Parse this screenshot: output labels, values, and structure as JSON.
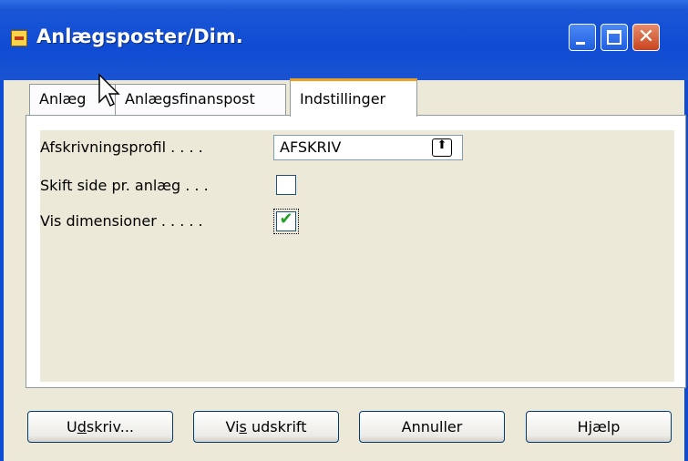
{
  "window": {
    "title": "Anlægsposter/Dim.",
    "icon": "app-icon",
    "controls": [
      "minimize",
      "maximize",
      "close"
    ]
  },
  "tabs": [
    {
      "label": "Anlæg",
      "active": false
    },
    {
      "label": "Anlægsfinanspost",
      "active": false
    },
    {
      "label": "Indstillinger",
      "active": true
    }
  ],
  "options": {
    "profile_label": "Afskrivningsprofil . . . .",
    "profile_value": "AFSKRIV",
    "newpage_label": "Skift side pr. anlæg . . .",
    "newpage_checked": false,
    "dims_label": "Vis dimensioner . . . . .",
    "dims_checked": true
  },
  "buttons": {
    "print_pre": "U",
    "print_ul": "d",
    "print_post": "skriv...",
    "preview_pre": "Vi",
    "preview_ul": "s",
    "preview_post": " udskrift",
    "cancel": "Annuller",
    "help": "Hjælp"
  },
  "colors": {
    "titlebar": "#0f4cd3",
    "tab_highlight": "#f0a022",
    "face": "#ECE9D8",
    "check": "#21a121"
  }
}
